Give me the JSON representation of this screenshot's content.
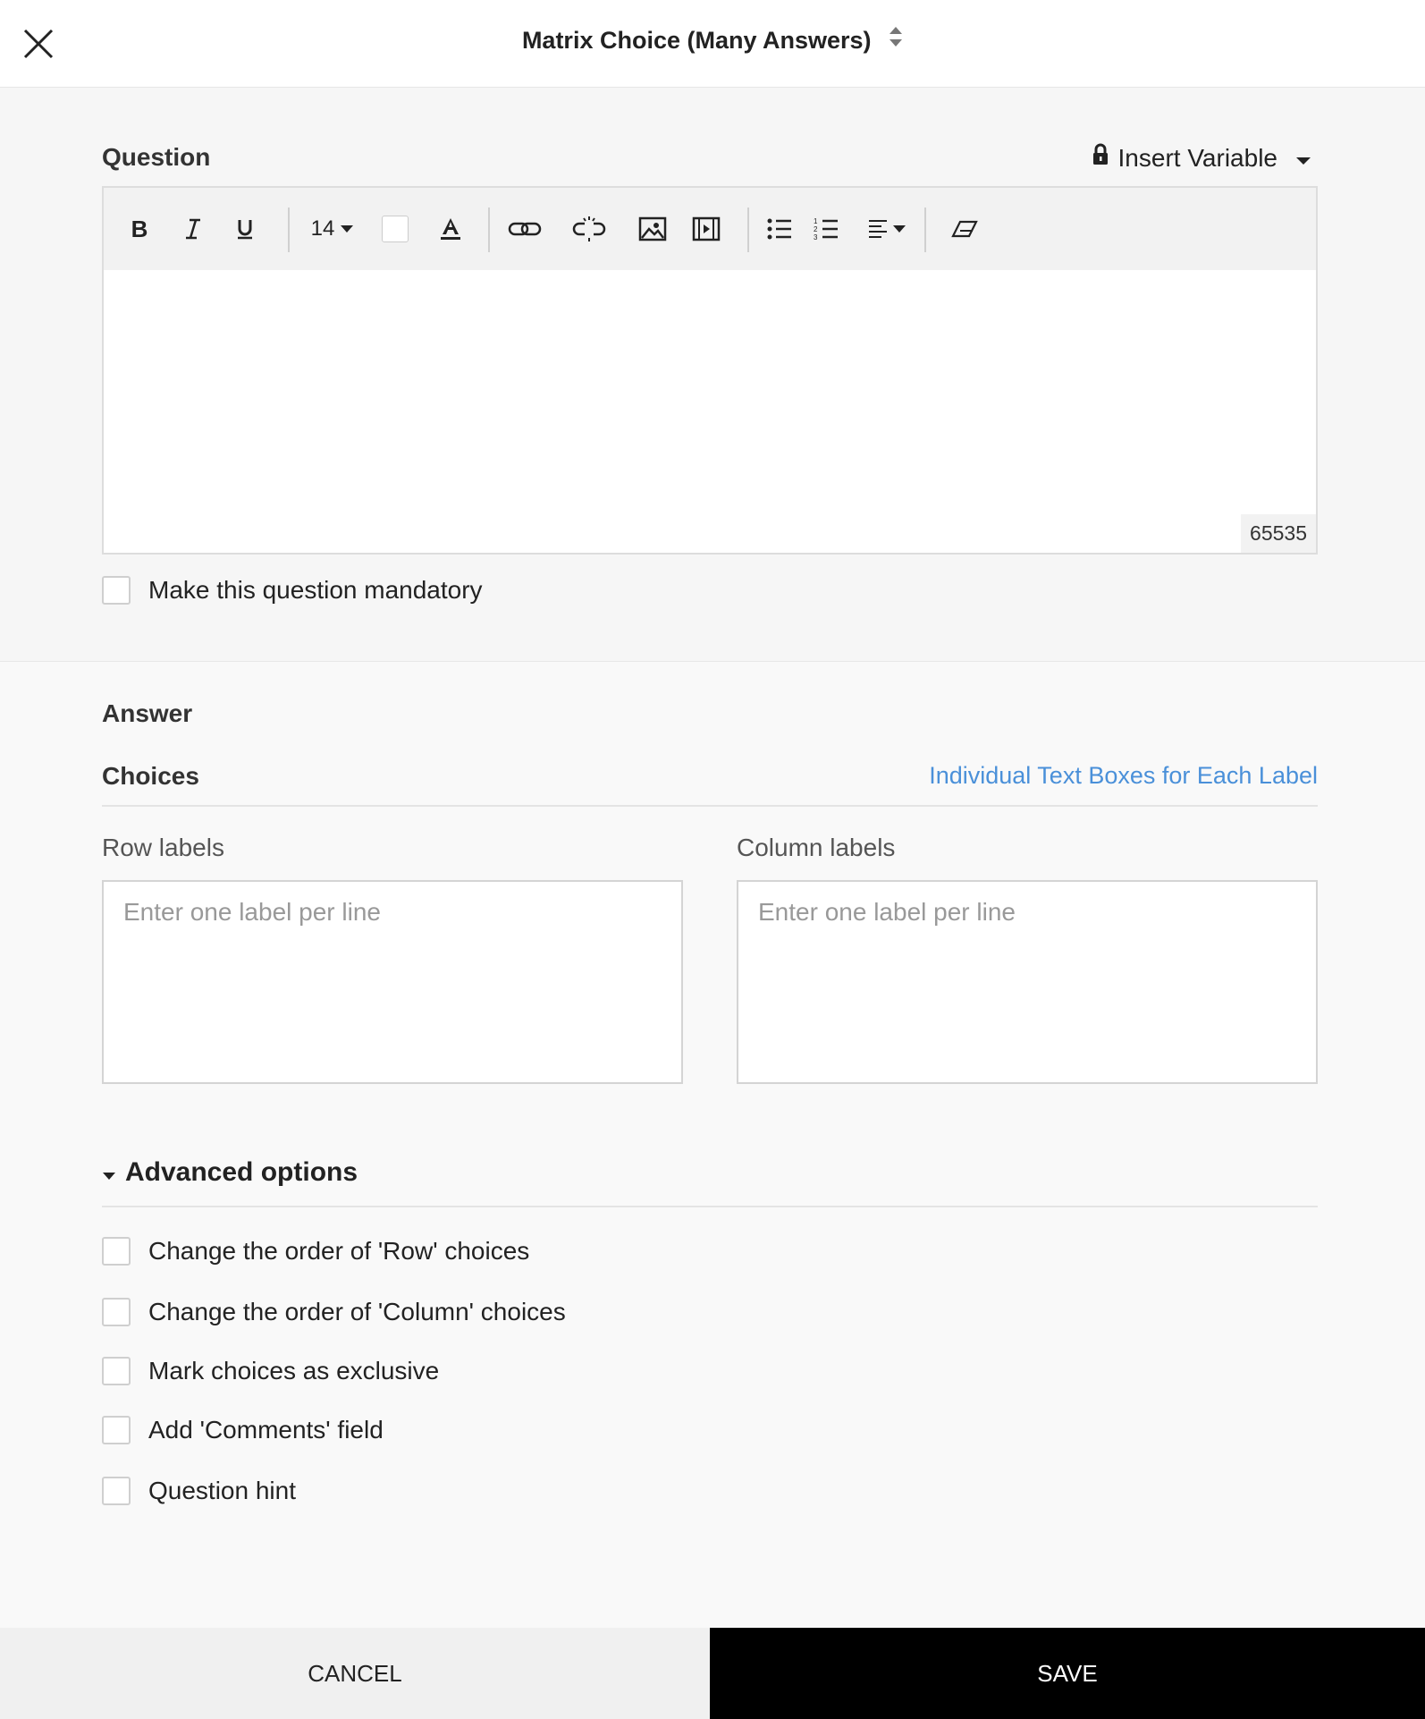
{
  "header": {
    "title": "Matrix Choice (Many Answers)"
  },
  "question": {
    "label": "Question",
    "insert_variable": "Insert Variable",
    "toolbar": {
      "font_size": "14",
      "icons": [
        "bold-icon",
        "italic-icon",
        "underline-icon",
        "font-size-dropdown",
        "background-color-swatch",
        "text-color-icon",
        "link-icon",
        "unlink-icon",
        "image-icon",
        "video-icon",
        "bullet-list-icon",
        "numbered-list-icon",
        "align-icon",
        "eraser-icon"
      ]
    },
    "char_count": "65535",
    "mandatory_label": "Make this question mandatory"
  },
  "answer": {
    "label": "Answer",
    "choices_label": "Choices",
    "individual_link": "Individual Text Boxes for Each Label",
    "row_labels_title": "Row labels",
    "column_labels_title": "Column labels",
    "row_placeholder": "Enter one label per line",
    "column_placeholder": "Enter one label per line"
  },
  "advanced": {
    "title": "Advanced options",
    "options": [
      "Change the order of 'Row' choices",
      "Change the order of 'Column' choices",
      "Mark choices as exclusive",
      "Add 'Comments' field",
      "Question hint"
    ]
  },
  "footer": {
    "cancel": "CANCEL",
    "save": "SAVE"
  },
  "colors": {
    "link": "#4a90d9",
    "save_bg": "#000000",
    "cancel_bg": "#f0f0f0"
  }
}
